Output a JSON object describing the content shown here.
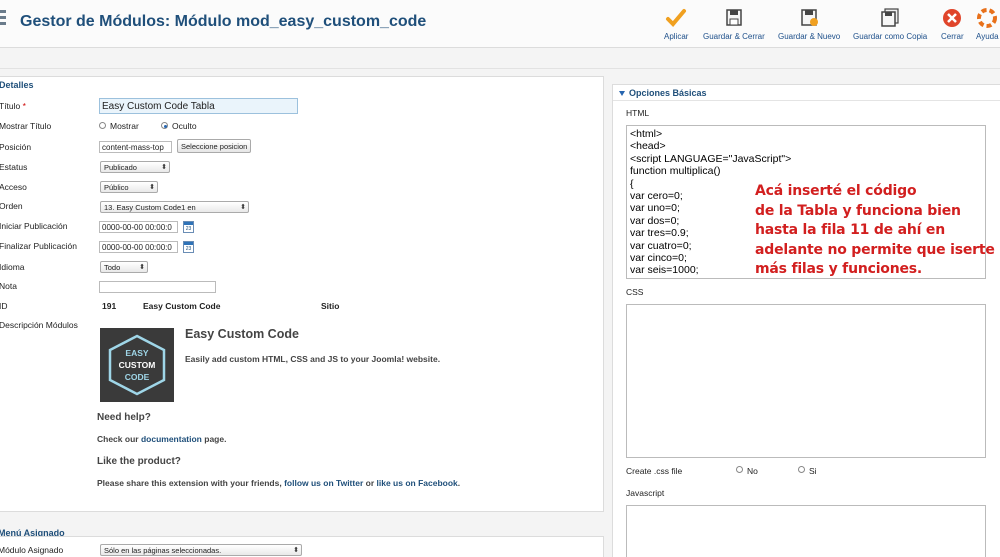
{
  "header": {
    "title": "Gestor de Módulos: Módulo mod_easy_custom_code",
    "toolbar": {
      "apply": "Aplicar",
      "save_close": "Guardar & Cerrar",
      "save_new": "Guardar & Nuevo",
      "save_copy": "Guardar como Copia",
      "close": "Cerrar",
      "help": "Ayuda"
    }
  },
  "details": {
    "legend": "Detalles",
    "labels": {
      "title": "Título",
      "required_mark": "*",
      "show_title": "Mostrar Título",
      "position": "Posición",
      "status": "Estatus",
      "access": "Acceso",
      "order": "Orden",
      "start_pub": "Iniciar Publicación",
      "end_pub": "Finalizar Publicación",
      "language": "Idioma",
      "note": "Nota",
      "id": "ID",
      "description": "Descripción Módulos"
    },
    "title_value": "Easy Custom Code Tabla",
    "show_title_options": {
      "show": "Mostrar",
      "hide": "Oculto",
      "selected": "hide"
    },
    "position_value": "content-mass-top",
    "select_position_button": "Seleccione posicion",
    "status_value": "Publicado",
    "access_value": "Público",
    "order_value": "13. Easy Custom Code1 en",
    "start_pub_value": "0000-00-00 00:00:0",
    "end_pub_value": "0000-00-00 00:00:0",
    "language_value": "Todo",
    "note_value": "",
    "id_value": "191",
    "id_name": "Easy Custom Code",
    "id_site": "Sitio",
    "calendar_icon_text": "23",
    "description": {
      "logo_lines": [
        "EASY",
        "CUSTOM",
        "CODE"
      ],
      "heading": "Easy Custom Code",
      "tagline": "Easily add custom HTML, CSS and JS to your Joomla! website.",
      "need_help": "Need help?",
      "check_prefix": "Check our",
      "check_link": "documentation",
      "check_suffix": "page.",
      "like": "Like the product?",
      "share_prefix": "Please share this extension with your friends,",
      "share_link1": "follow us on Twitter",
      "share_or": "or",
      "share_link2": "like us on Facebook",
      "share_suffix": "."
    }
  },
  "menu_assignment": {
    "legend": "Menú Asignado",
    "label": "Módulo Asignado",
    "value": "Sólo en las páginas seleccionadas."
  },
  "basic_options": {
    "title": "Opciones Básicas",
    "html_label": "HTML",
    "html_code": [
      "<html>",
      "<head>",
      "<script LANGUAGE=\"JavaScript\">",
      "function multiplica()",
      "{",
      "var cero=0;",
      "var uno=0;",
      "var dos=0;",
      "var tres=0.9;",
      "var cuatro=0;",
      "var cinco=0;",
      "var seis=1000;"
    ],
    "css_label": "CSS",
    "create_css_label": "Create .css file",
    "create_css_options": {
      "no": "No",
      "yes": "Si"
    },
    "js_label": "Javascript"
  },
  "annotation": [
    "Acá inserté el código",
    "de la Tabla y funciona bien",
    "hasta la fila 11 de ahí en",
    "adelante no permite que iserte",
    "más filas y funciones."
  ],
  "colors": {
    "title_blue": "#1f4f7a",
    "annotation_red": "#d21f1f",
    "apply_orange": "#f0a020",
    "close_red": "#e0452b"
  }
}
